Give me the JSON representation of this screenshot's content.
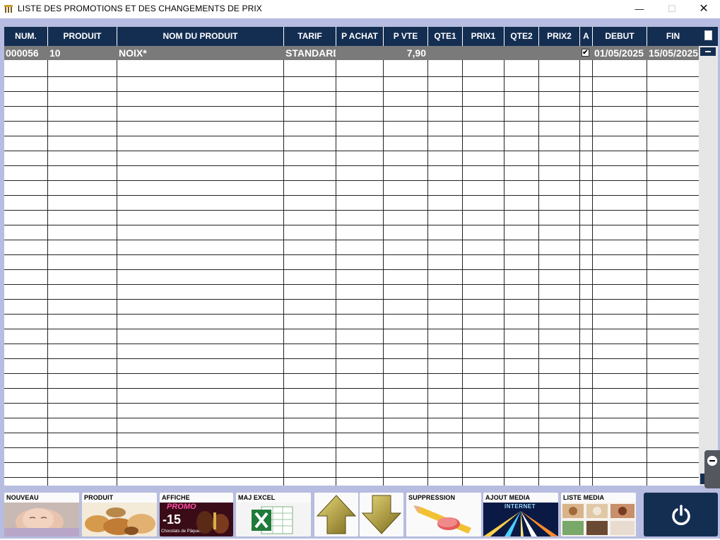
{
  "window": {
    "title": "LISTE DES PROMOTIONS ET DES CHANGEMENTS DE PRIX",
    "minimize_glyph": "—",
    "maximize_glyph": "☐",
    "close_glyph": "✕"
  },
  "table": {
    "columns": [
      "NUM.",
      "PRODUIT",
      "NOM DU PRODUIT",
      "TARIF",
      "P ACHAT",
      "P VTE",
      "QTE1",
      "PRIX1",
      "QTE2",
      "PRIX2",
      "A",
      "DEBUT",
      "FIN"
    ],
    "rows": [
      {
        "num": "000056",
        "produit": "10",
        "nom": "NOIX*",
        "tarif": "STANDARD",
        "p_achat": "",
        "p_vte": "7,90",
        "qte1": "",
        "prix1": "",
        "qte2": "",
        "prix2": "",
        "a_checked": true,
        "a_mark": "✔",
        "debut": "01/05/2025",
        "fin": "15/05/2025"
      }
    ]
  },
  "toolbar": {
    "nouveau": "NOUVEAU",
    "produit": "PRODUIT",
    "affiche": "AFFICHE",
    "affiche_promo_text": "PROMO",
    "affiche_percent": "-15",
    "affiche_caption": "Chocolats de Pâques",
    "maj_excel": "MAJ EXCEL",
    "suppression": "SUPPRESSION",
    "ajout_media": "AJOUT MEDIA",
    "ajout_media_tag": "INTERNET",
    "liste_media": "LISTE MEDIA"
  },
  "icons": {
    "app": "app-window-icon",
    "up": "arrow-up-icon",
    "down": "arrow-down-icon",
    "power": "power-icon"
  },
  "colors": {
    "header_bg": "#142e52",
    "frame_bg": "#b7bde0",
    "selected_row_bg": "#7a7a7a"
  }
}
